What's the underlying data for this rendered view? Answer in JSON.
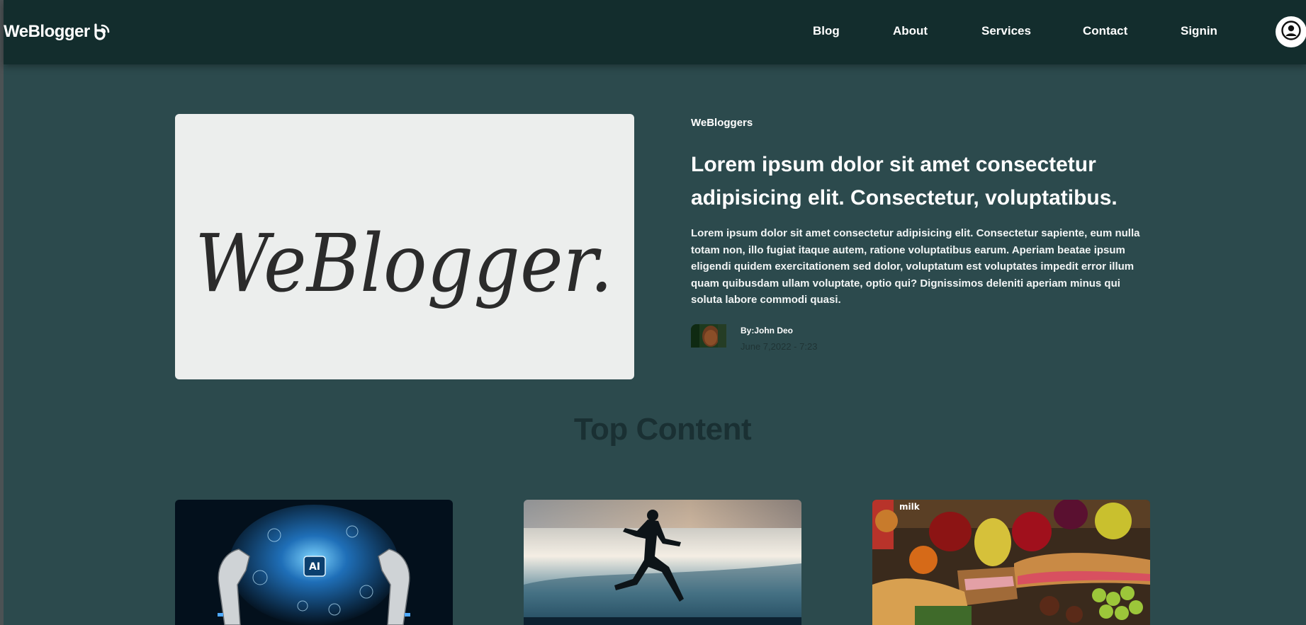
{
  "brand": {
    "name": "WeBlogger"
  },
  "nav": {
    "links": [
      "Blog",
      "About",
      "Services",
      "Contact",
      "Signin"
    ]
  },
  "hero": {
    "image_text": "WeBlogger.",
    "tag": "WeBloggers",
    "title": "Lorem ipsum dolor sit amet consectetur adipisicing elit. Consectetur, voluptatibus.",
    "body": "Lorem ipsum dolor sit amet consectetur adipisicing elit. Consectetur sapiente, eum nulla totam non, illo fugiat itaque autem, ratione voluptatibus earum. Aperiam beatae ipsum eligendi quidem exercitationem sed dolor, voluptatum est voluptates impedit error illum quam quibusdam ullam voluptate, optio qui? Dignissimos deleniti aperiam minus qui soluta labore commodi quasi.",
    "author": "By:John Deo",
    "date": "June 7,2022 - 7:23"
  },
  "top_content": {
    "title": "Top Content",
    "cards": [
      {
        "image": "ai-brain-robot-hands",
        "badge": "AI"
      },
      {
        "image": "runner-silhouette"
      },
      {
        "image": "food-picnic",
        "badge": "milk"
      }
    ]
  },
  "colors": {
    "page_bg": "#2c4a4d",
    "navbar_bg": "#132d2d",
    "hero_image_bg": "#eceeed",
    "section_title": "#1a3033"
  }
}
